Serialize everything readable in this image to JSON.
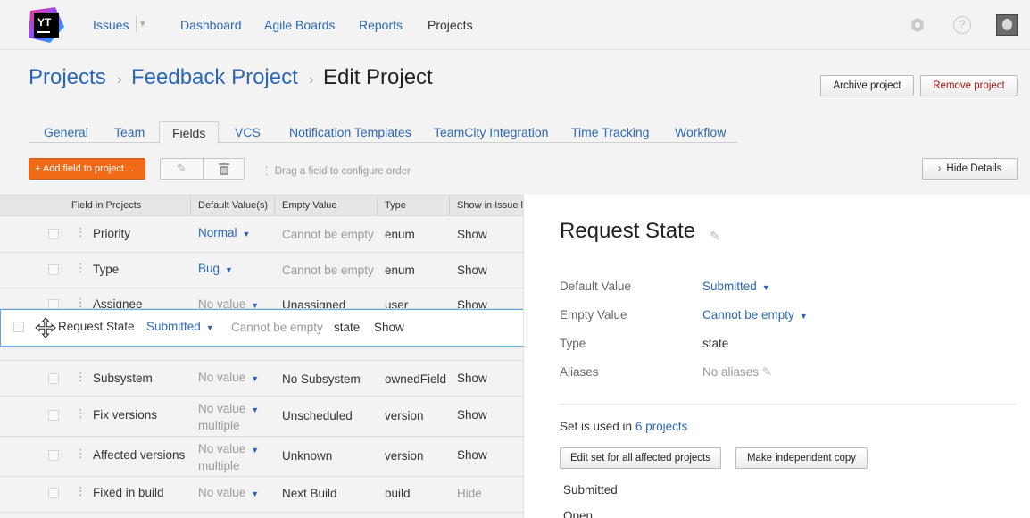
{
  "nav": {
    "logo": "YT",
    "issues": "Issues",
    "issues_caret": "▾",
    "dashboard": "Dashboard",
    "agile": "Agile Boards",
    "reports": "Reports",
    "projects": "Projects"
  },
  "breadcrumb": {
    "projects": "Projects",
    "project": "Feedback Project",
    "current": "Edit Project",
    "sep": "›"
  },
  "actions": {
    "archive": "Archive project",
    "remove": "Remove project"
  },
  "tabs": [
    "General",
    "Team",
    "Fields",
    "VCS",
    "Notification Templates",
    "TeamCity Integration",
    "Time Tracking",
    "Workflow"
  ],
  "toolbar": {
    "add": "+ Add field to project…",
    "hint": "⋮  Drag a field to configure order",
    "hide": "Hide Details"
  },
  "table": {
    "headers": [
      "Field in Projects",
      "Default Value(s)",
      "Empty Value",
      "Type",
      "Show in Issue l"
    ],
    "rows": [
      {
        "name": "Priority",
        "default": "Normal",
        "default2": "",
        "empty": "Cannot be empty",
        "type": "enum",
        "show": "Show"
      },
      {
        "name": "Type",
        "default": "Bug",
        "default2": "",
        "empty": "Cannot be empty",
        "type": "enum",
        "show": "Show"
      },
      {
        "name": "Assignee",
        "default": "No value",
        "default2": "",
        "empty": "Unassigned",
        "type": "user",
        "show": "Show"
      },
      {
        "name": "Subsystem",
        "default": "No value",
        "default2": "",
        "empty": "No Subsystem",
        "type": "ownedField",
        "show": "Show"
      },
      {
        "name": "Fix versions",
        "default": "No value",
        "default2": "multiple",
        "empty": "Unscheduled",
        "type": "version",
        "show": "Show"
      },
      {
        "name": "Affected versions",
        "default": "No value",
        "default2": "multiple",
        "empty": "Unknown",
        "type": "version",
        "show": "Show"
      },
      {
        "name": "Fixed in build",
        "default": "No value",
        "default2": "",
        "empty": "Next Build",
        "type": "build",
        "show": "Hide"
      }
    ],
    "drag": {
      "name": "Request State",
      "default": "Submitted",
      "empty": "Cannot be empty",
      "type": "state",
      "show": "Show"
    }
  },
  "details": {
    "title": "Request State",
    "labels": {
      "default": "Default Value",
      "empty": "Empty Value",
      "type": "Type",
      "aliases": "Aliases"
    },
    "values": {
      "default": "Submitted",
      "empty": "Cannot be empty",
      "type": "state",
      "aliases": "No aliases"
    },
    "used_prefix": "Set is used in",
    "used_link": "6 projects",
    "edit_all": "Edit set for all affected projects",
    "copy": "Make independent copy",
    "values_list": [
      "Submitted",
      "Open"
    ]
  }
}
